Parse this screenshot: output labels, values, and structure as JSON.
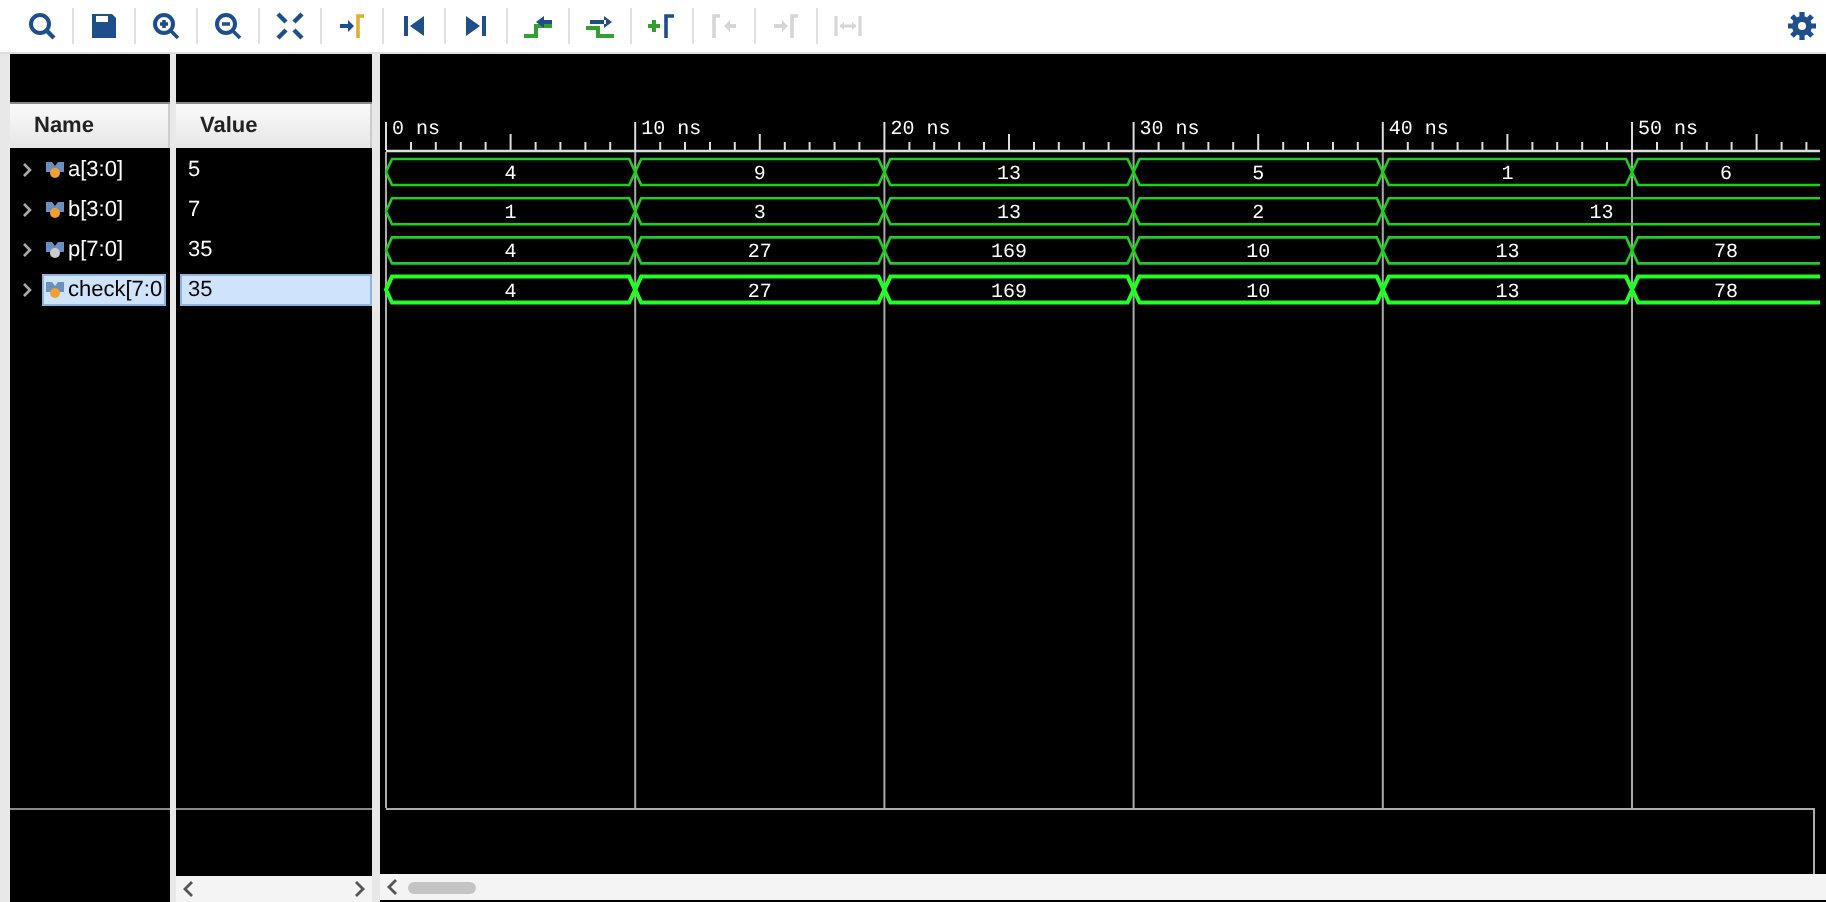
{
  "toolbar": {
    "tools": [
      {
        "kind": "search",
        "disabled": false
      },
      {
        "kind": "save",
        "disabled": false
      },
      {
        "kind": "zoom-in",
        "disabled": false
      },
      {
        "kind": "zoom-out",
        "disabled": false
      },
      {
        "kind": "fit",
        "disabled": false
      },
      {
        "kind": "go-cursor",
        "disabled": false
      },
      {
        "kind": "go-start",
        "disabled": false
      },
      {
        "kind": "go-end",
        "disabled": false
      },
      {
        "kind": "prev-edge",
        "disabled": false
      },
      {
        "kind": "next-edge",
        "disabled": false
      },
      {
        "kind": "add-marker",
        "disabled": false
      },
      {
        "kind": "prev-marker",
        "disabled": true
      },
      {
        "kind": "next-marker",
        "disabled": true
      },
      {
        "kind": "swap",
        "disabled": true
      }
    ]
  },
  "columns": {
    "name": "Name",
    "value": "Value"
  },
  "ruler": {
    "labels": [
      "0 ns",
      "10 ns",
      "20 ns",
      "30 ns",
      "40 ns",
      "50 ns"
    ]
  },
  "signals": [
    {
      "name": "a[3:0]",
      "value": "5",
      "selected": false,
      "segments": [
        {
          "value": "4",
          "held": false
        },
        {
          "value": "9",
          "held": false
        },
        {
          "value": "13",
          "held": false
        },
        {
          "value": "5",
          "held": false
        },
        {
          "value": "1",
          "held": false
        },
        {
          "value": "6",
          "held": false
        }
      ]
    },
    {
      "name": "b[3:0]",
      "value": "7",
      "selected": false,
      "segments": [
        {
          "value": "1",
          "held": false
        },
        {
          "value": "3",
          "held": false
        },
        {
          "value": "13",
          "held": false
        },
        {
          "value": "2",
          "held": false
        },
        {
          "value": "13",
          "held": true
        }
      ]
    },
    {
      "name": "p[7:0]",
      "value": "35",
      "selected": false,
      "segments": [
        {
          "value": "4",
          "held": false
        },
        {
          "value": "27",
          "held": false
        },
        {
          "value": "169",
          "held": false
        },
        {
          "value": "10",
          "held": false
        },
        {
          "value": "13",
          "held": false
        },
        {
          "value": "78",
          "held": false
        }
      ]
    },
    {
      "name": "check[7:0",
      "value": "35",
      "selected": true,
      "segments": [
        {
          "value": "4",
          "held": false
        },
        {
          "value": "27",
          "held": false
        },
        {
          "value": "169",
          "held": false
        },
        {
          "value": "10",
          "held": false
        },
        {
          "value": "13",
          "held": false
        },
        {
          "value": "78",
          "held": false
        }
      ]
    }
  ]
}
